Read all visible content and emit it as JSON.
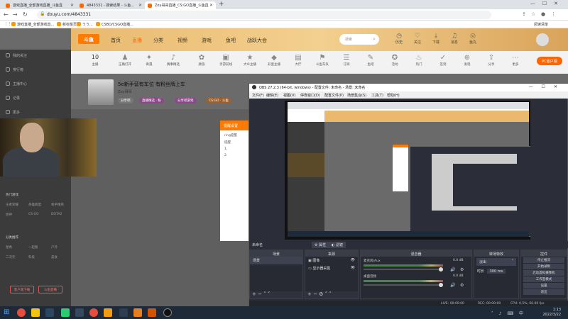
{
  "browser": {
    "tabs": [
      {
        "label": "游戏直播_全部游戏直播_斗鱼直",
        "active": false
      },
      {
        "label": "4843331 - 搜索结果 - 斗鱼直播",
        "active": false
      },
      {
        "label": "Zoy哥哥直播_CS:GO直播_斗鱼直",
        "active": true
      }
    ],
    "url": "douyu.com/4843331",
    "bookmarks": [
      "游戏直播_全部游戏直...",
      "新标签页",
      "うう...",
      "CSBO/CSGO直播..."
    ],
    "reading_list": "阅读清单"
  },
  "douyu": {
    "logo": "斗鱼",
    "nav": [
      "首页",
      "直播",
      "分类",
      "视频",
      "游戏",
      "鱼吧",
      "战跃大会"
    ],
    "search_placeholder": "搜索",
    "header_icons": [
      "历史",
      "关注",
      "下载",
      "消息",
      "鱼丸"
    ],
    "categories": [
      "10",
      "正确打开",
      "奇遇",
      "赛事精选",
      "颜值",
      "手游前线",
      "大众主播",
      "彩蛋主播",
      "大厅",
      "斗鱼车队",
      "订阅",
      "鱼吧",
      "活动",
      "热门",
      "签到",
      "发现",
      "分享",
      "更多"
    ],
    "categories_count_label": "主播",
    "pc_button": "PC客户端",
    "sidebar": {
      "items": [
        "我的关注",
        "排行榜",
        "主播中心",
        "记录",
        "更多"
      ],
      "sub_heading_1": "热门游戏",
      "sub_items_1": [
        "王者荣耀",
        "英雄联盟",
        "和平精英",
        "原神",
        "CS:GO",
        "DOTA2"
      ],
      "sub_heading_2": "分类推荐",
      "sub_items_2": [
        "星秀",
        "一起看",
        "户外",
        "二次元",
        "科技",
        "美食"
      ],
      "btn_left": "客户端下载",
      "btn_right": "斗鱼直播"
    },
    "room": {
      "title": "5e新手营有车位 有粉丝牌上车",
      "streamer": "Zoy哥哥",
      "tags": [
        "分享吧",
        "直播精选 · 粉",
        "分享吧游戏",
        "CS:GO · 斗鱼"
      ],
      "popup_title": "提醒设置",
      "popup_lines": [
        "ring提醒",
        "提醒",
        "1.",
        "2."
      ]
    }
  },
  "obs": {
    "title": "OBS 27.2.3 (64-bit, windows) - 配置文件: 未命名 - 场景: 未命名",
    "menu": [
      "文件(F)",
      "编辑(E)",
      "视图(V)",
      "停靠窗口(D)",
      "配置文件(P)",
      "场景集合(S)",
      "工具(T)",
      "帮助(H)"
    ],
    "scene_label": "未命名",
    "properties_btn": "属性",
    "filters_btn": "滤镜",
    "docks": {
      "scenes": {
        "title": "场景",
        "items": [
          "场景"
        ]
      },
      "sources": {
        "title": "来源",
        "items": [
          "图像",
          "显示器采集"
        ]
      },
      "mixer": {
        "title": "混音器",
        "channels": [
          {
            "name": "麦克风/Aux",
            "db": "0.0 dB"
          },
          {
            "name": "桌面音频",
            "db": "0.0 dB"
          }
        ]
      },
      "transitions": {
        "title": "转场特效",
        "type": "淡出",
        "duration_label": "时长",
        "duration": "300 ms"
      },
      "controls": {
        "title": "控件",
        "buttons": [
          "停止推流",
          "开始录制",
          "启动虚拟摄像机",
          "工作室模式",
          "设置",
          "退出"
        ]
      }
    },
    "status": {
      "drop": "LIVE: 00:00:00",
      "rec": "REC: 00:00:00",
      "cpu": "CPU: 0.5%, 60.00 fps",
      "bitrate": "kb/s: 0"
    }
  },
  "taskbar": {
    "time": "1:13",
    "date": "2022/3/22"
  }
}
